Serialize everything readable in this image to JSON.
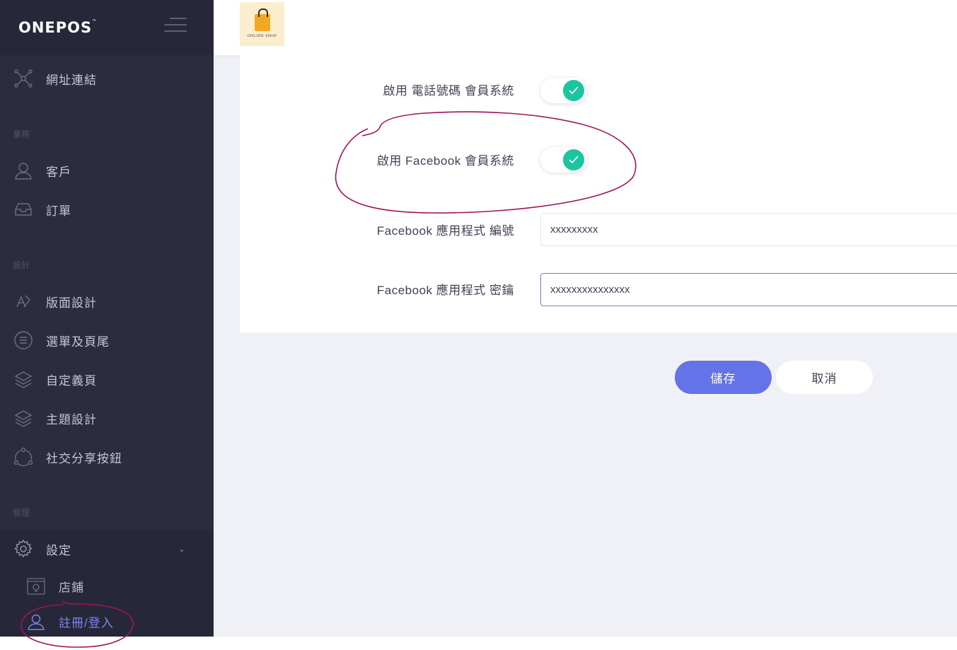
{
  "brand": {
    "name": "ONEPOS",
    "tm": "™"
  },
  "shop_logo": {
    "text": "ONLINE SHOP"
  },
  "sidebar": {
    "link_item": {
      "label": "網址連結",
      "icon": "network-icon"
    },
    "sections": {
      "business": "業務",
      "design": "設計",
      "manage": "管理"
    },
    "business_items": [
      {
        "label": "客戶",
        "icon": "user-icon"
      },
      {
        "label": "訂單",
        "icon": "inbox-icon"
      }
    ],
    "design_items": [
      {
        "label": "版面設計",
        "icon": "layout-icon"
      },
      {
        "label": "選單及頁尾",
        "icon": "menu-icon"
      },
      {
        "label": "自定義頁",
        "icon": "layers-icon"
      },
      {
        "label": "主題設計",
        "icon": "layers-icon"
      },
      {
        "label": "社交分享按鈕",
        "icon": "share-icon"
      }
    ],
    "settings": {
      "label": "設定",
      "icon": "gear-icon",
      "sub_items": [
        {
          "label": "店鋪",
          "icon": "store-icon"
        },
        {
          "label": "註冊/登入",
          "icon": "user-icon",
          "active": true
        }
      ]
    }
  },
  "form": {
    "phone_member": {
      "label": "啟用 電話號碼 會員系統",
      "enabled": true
    },
    "facebook_member": {
      "label": "啟用 Facebook 會員系統",
      "enabled": true
    },
    "fb_app_id": {
      "label": "Facebook 應用程式 編號",
      "value": "xxxxxxxxx"
    },
    "fb_app_secret": {
      "label": "Facebook 應用程式 密鑰",
      "value": "xxxxxxxxxxxxxxx"
    }
  },
  "actions": {
    "save": "儲存",
    "cancel": "取消"
  },
  "colors": {
    "sidebar_bg": "#2b2d3f",
    "accent": "#6473e8",
    "toggle_on": "#1bc5a0",
    "annotation": "#a0135a"
  }
}
